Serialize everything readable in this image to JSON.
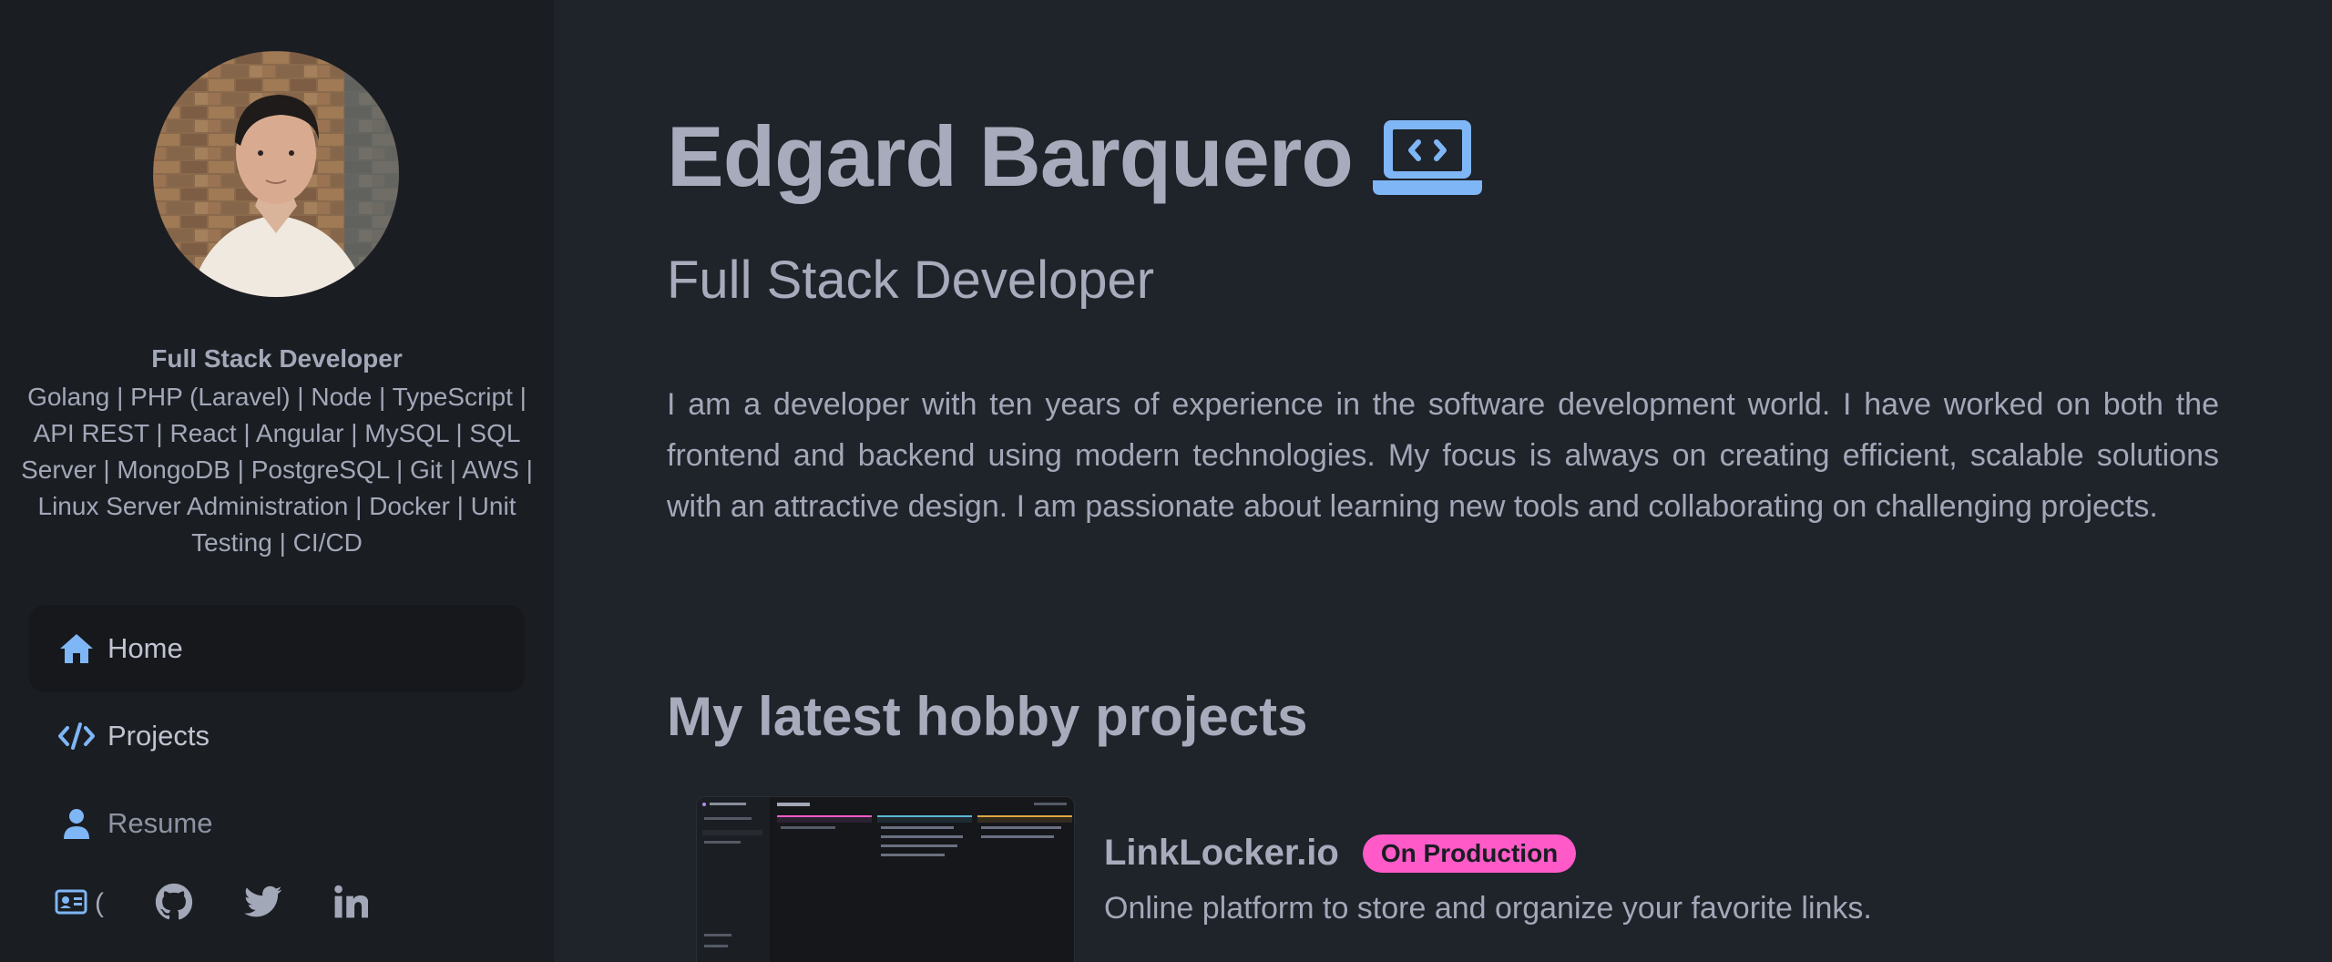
{
  "sidebar": {
    "title": "Full Stack Developer",
    "skills": "Golang | PHP (Laravel) | Node | TypeScript | API REST | React | Angular | MySQL | SQL Server | MongoDB | PostgreSQL | Git | AWS | Linux Server Administration | Docker | Unit Testing | CI/CD",
    "nav": [
      {
        "label": "Home",
        "icon": "home-icon",
        "active": true
      },
      {
        "label": "Projects",
        "icon": "code-icon"
      },
      {
        "label": "Resume",
        "icon": "user-icon"
      }
    ],
    "social": [
      {
        "icon": "contact-card-icon",
        "partial_label": "("
      },
      {
        "icon": "github-icon"
      },
      {
        "icon": "twitter-icon"
      },
      {
        "icon": "linkedin-icon"
      }
    ]
  },
  "header": {
    "name": "Edgard Barquero",
    "name_icon": "laptop-code-icon",
    "role": "Full Stack Developer",
    "bio": "I am a developer with ten years of experience in the software development world. I have worked on both the frontend and backend using modern technologies. My focus is always on creating efficient, scalable solutions with an attractive design. I am passionate about learning new tools and collaborating on challenging projects."
  },
  "projects": {
    "heading": "My latest hobby projects",
    "items": [
      {
        "name": "LinkLocker.io",
        "badge": "On Production",
        "description": "Online platform to store and organize your favorite links."
      }
    ]
  },
  "colors": {
    "accent": "#7fb6f5",
    "badge": "#ff5ac8",
    "sidebar_bg": "#1a1d22",
    "main_bg": "#1f232a"
  }
}
